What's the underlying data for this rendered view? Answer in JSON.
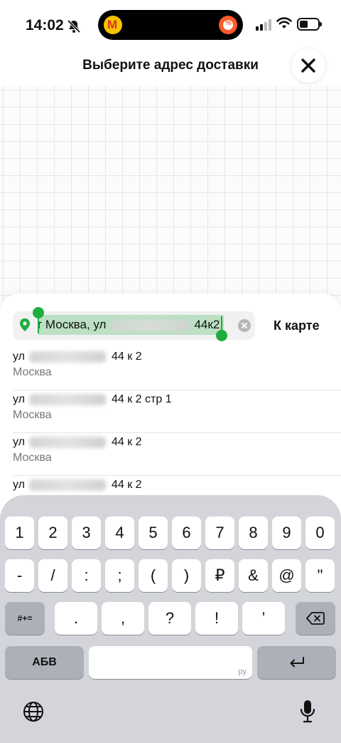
{
  "status_bar": {
    "time": "14:02"
  },
  "header": {
    "title": "Выберите адрес доставки"
  },
  "search": {
    "value_prefix": "г Москва, ул",
    "value_suffix": "44к2",
    "to_map_label": "К карте"
  },
  "results": [
    {
      "prefix": "ул",
      "suffix": "44 к 2",
      "city": "Москва"
    },
    {
      "prefix": "ул",
      "suffix": "44 к 2 стр 1",
      "city": "Москва"
    },
    {
      "prefix": "ул",
      "suffix": "44 к 2",
      "city": "Москва"
    },
    {
      "prefix": "ул",
      "suffix": "44 к 2",
      "city": ""
    }
  ],
  "keyboard": {
    "row1": [
      "1",
      "2",
      "3",
      "4",
      "5",
      "6",
      "7",
      "8",
      "9",
      "0"
    ],
    "row2": [
      "-",
      "/",
      ":",
      ";",
      "(",
      ")",
      "₽",
      "&",
      "@",
      "\""
    ],
    "row3_mode": "#+=",
    "row3": [
      ".",
      ",",
      "?",
      "!",
      "’"
    ],
    "abc_label": "АБВ",
    "space_hint": "ру"
  }
}
